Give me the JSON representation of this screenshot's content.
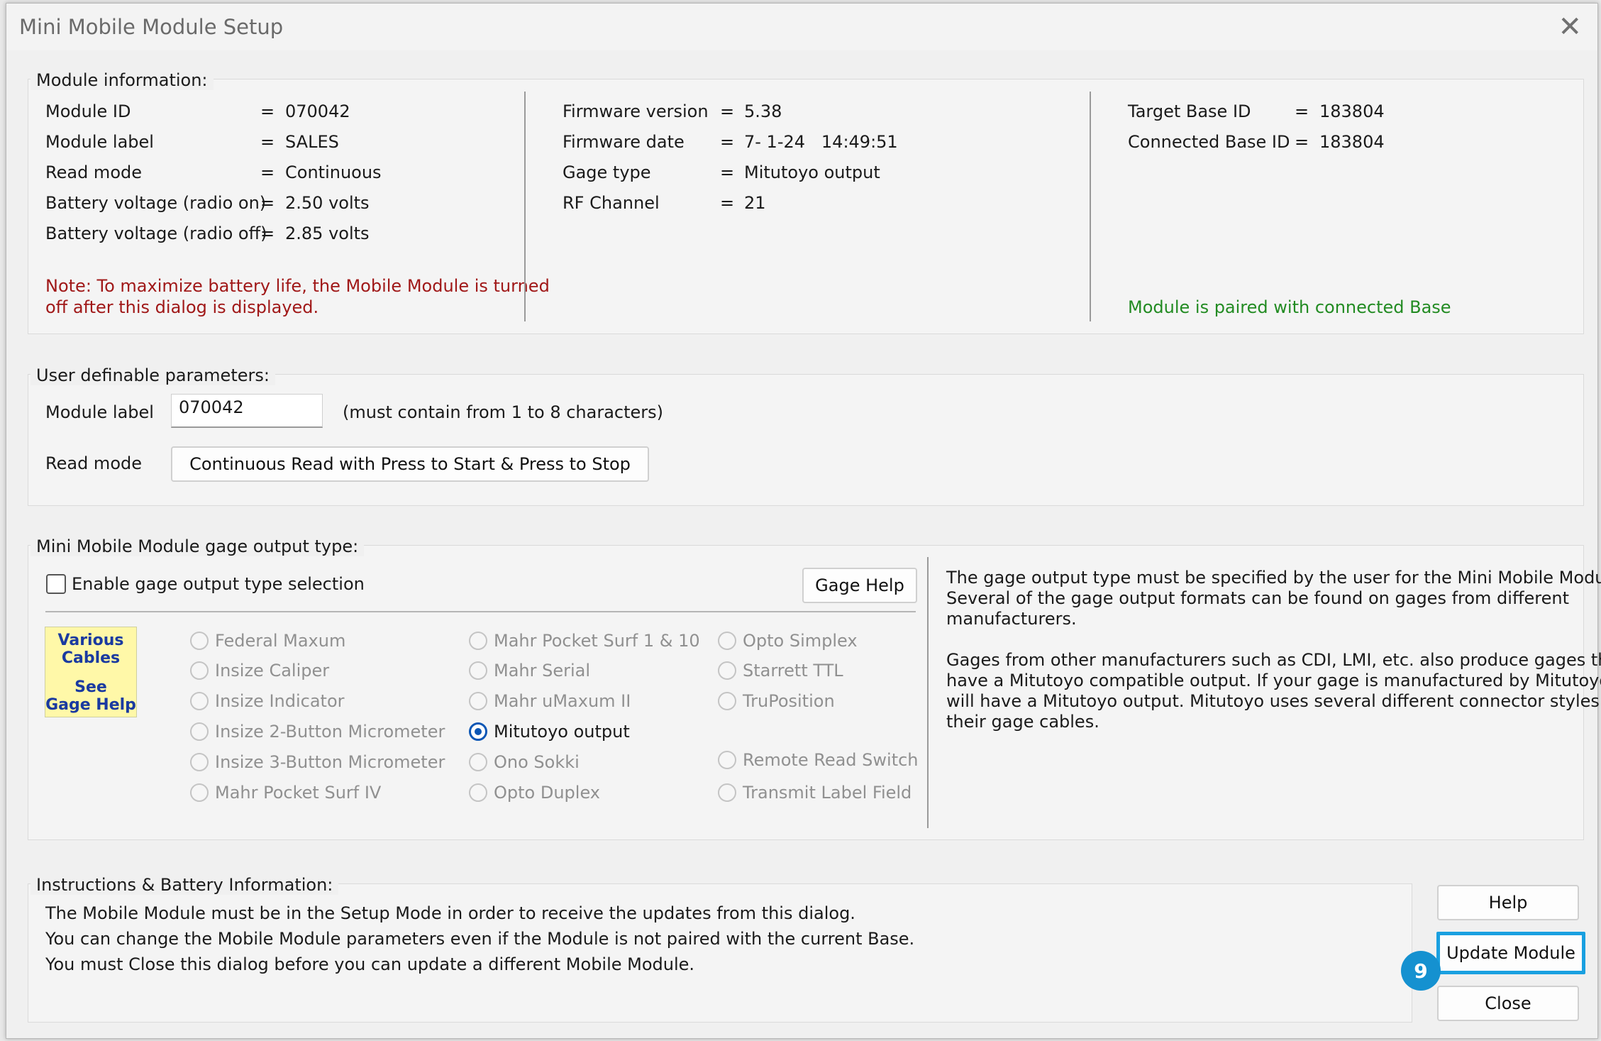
{
  "window": {
    "title": "Mini Mobile Module Setup"
  },
  "module_info": {
    "legend": "Module information:",
    "col1": [
      {
        "label": "Module ID",
        "value": "070042"
      },
      {
        "label": "Module label",
        "value": "SALES"
      },
      {
        "label": "Read mode",
        "value": "Continuous"
      },
      {
        "label": "Battery voltage (radio on)",
        "value": "2.50 volts"
      },
      {
        "label": "Battery voltage (radio off)",
        "value": "2.85 volts"
      }
    ],
    "note_line1": "Note: To maximize battery life, the Mobile Module is turned",
    "note_line2": "off after this dialog is displayed.",
    "col2": [
      {
        "label": "Firmware version",
        "value": "5.38"
      },
      {
        "label": "Firmware date",
        "value": "7- 1-24   14:49:51"
      },
      {
        "label": "Gage type",
        "value": "Mitutoyo output"
      },
      {
        "label": "RF Channel",
        "value": "21"
      }
    ],
    "col3": [
      {
        "label": "Target Base ID",
        "value": "183804"
      },
      {
        "label": "Connected Base ID",
        "value": "183804"
      }
    ],
    "paired_status": "Module is paired with connected Base",
    "equals": "="
  },
  "user_params": {
    "legend": "User definable parameters:",
    "module_label": "Module label",
    "module_label_value": "070042",
    "module_label_hint": "(must contain from 1 to 8 characters)",
    "read_mode": "Read mode",
    "read_mode_button": "Continuous Read with Press to Start & Press to Stop"
  },
  "gage_output": {
    "legend": "Mini Mobile Module gage output type:",
    "enable_checkbox": "Enable gage output type selection",
    "gage_help_button": "Gage Help",
    "various_line1": "Various",
    "various_line2": "Cables",
    "various_line3": "See",
    "various_line4": "Gage Help",
    "col1": [
      "Federal Maxum",
      "Insize Caliper",
      "Insize Indicator",
      "Insize 2-Button Micrometer",
      "Insize 3-Button Micrometer",
      "Mahr Pocket Surf IV"
    ],
    "col2": [
      "Mahr Pocket Surf 1 & 10",
      "Mahr Serial",
      "Mahr uMaxum II",
      "Mitutoyo output",
      "Ono Sokki",
      "Opto Duplex"
    ],
    "col3": [
      "Opto Simplex",
      "Starrett TTL",
      "TruPosition",
      "Remote Read Switch",
      "Transmit Label Field"
    ],
    "selected": "Mitutoyo output",
    "desc_p1_l1": "The gage output type must be specified by the user for the Mini Mobile Module.",
    "desc_p1_l2": "Several of the gage output formats can be found on gages from different",
    "desc_p1_l3": "manufacturers.",
    "desc_p2_l1": "Gages from other manufacturers such as CDI, LMI, etc. also produce gages that",
    "desc_p2_l2": "have a Mitutoyo compatible output.  If your gage is manufactured by Mitutoyo, it",
    "desc_p2_l3": "will have a Mitutoyo output.  Mitutoyo uses several different connector styles for",
    "desc_p2_l4": "their gage cables."
  },
  "instructions": {
    "legend": "Instructions & Battery Information:",
    "line1": "The Mobile Module must be in the Setup Mode in order to receive the updates from this dialog.",
    "line2": "You can change the Mobile Module parameters even if the Module is not paired with the current Base.",
    "line3": "You must Close this dialog before you can update a different Mobile Module."
  },
  "buttons": {
    "help": "Help",
    "update": "Update Module",
    "close": "Close"
  },
  "callout": {
    "number": "9",
    "color": "#1591d0"
  },
  "colors": {
    "note_red": "#a01818",
    "status_green": "#228b22",
    "highlight": "#1aa0e0",
    "radio_selected": "#0b56b5"
  }
}
